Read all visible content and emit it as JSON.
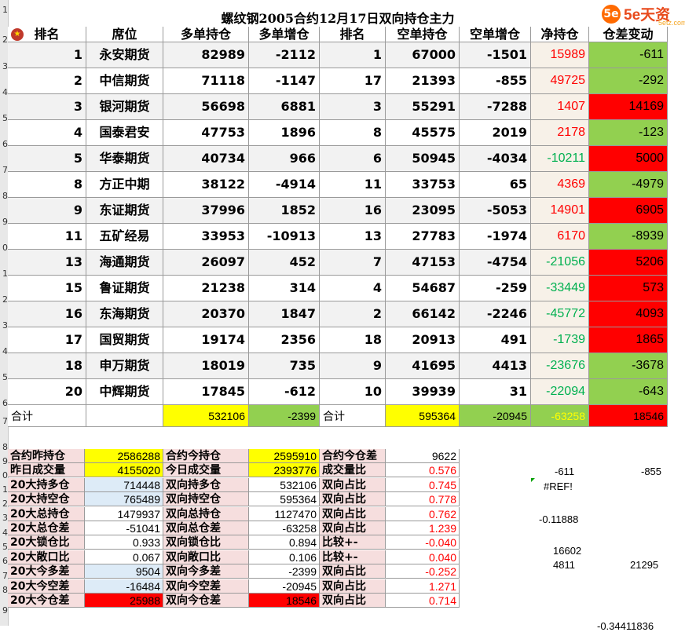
{
  "title": "螺纹钢2005合约12月17日双向持仓主力",
  "logo": {
    "mark": "5e",
    "text": "5e天资",
    "sub": "5etz.com"
  },
  "row_numbers": [
    "1",
    "2",
    "3",
    "4",
    "5",
    "6",
    "7",
    "8",
    "9",
    "0",
    "1",
    "2",
    "3",
    "4",
    "5",
    "6",
    "7",
    "8",
    "9",
    "0",
    "1",
    "2",
    "3",
    "4",
    "5",
    "6",
    "7",
    "8",
    "9"
  ],
  "headers": [
    "排名",
    "席位",
    "多单持仓",
    "多单增仓",
    "排名",
    "空单持仓",
    "空单增仓",
    "净持仓",
    "仓差变动"
  ],
  "rows": [
    {
      "rank": "1",
      "broker": "永安期货",
      "long": "82989",
      "long_chg": "-2112",
      "srank": "1",
      "short": "67000",
      "short_chg": "-1501",
      "net": "15989",
      "diff": "-611"
    },
    {
      "rank": "2",
      "broker": "中信期货",
      "long": "71118",
      "long_chg": "-1147",
      "srank": "17",
      "short": "21393",
      "short_chg": "-855",
      "net": "49725",
      "diff": "-292"
    },
    {
      "rank": "3",
      "broker": "银河期货",
      "long": "56698",
      "long_chg": "6881",
      "srank": "3",
      "short": "55291",
      "short_chg": "-7288",
      "net": "1407",
      "diff": "14169"
    },
    {
      "rank": "4",
      "broker": "国泰君安",
      "long": "47753",
      "long_chg": "1896",
      "srank": "8",
      "short": "45575",
      "short_chg": "2019",
      "net": "2178",
      "diff": "-123"
    },
    {
      "rank": "5",
      "broker": "华泰期货",
      "long": "40734",
      "long_chg": "966",
      "srank": "6",
      "short": "50945",
      "short_chg": "-4034",
      "net": "-10211",
      "diff": "5000"
    },
    {
      "rank": "8",
      "broker": "方正中期",
      "long": "38122",
      "long_chg": "-4914",
      "srank": "11",
      "short": "33753",
      "short_chg": "65",
      "net": "4369",
      "diff": "-4979"
    },
    {
      "rank": "9",
      "broker": "东证期货",
      "long": "37996",
      "long_chg": "1852",
      "srank": "16",
      "short": "23095",
      "short_chg": "-5053",
      "net": "14901",
      "diff": "6905"
    },
    {
      "rank": "11",
      "broker": "五矿经易",
      "long": "33953",
      "long_chg": "-10913",
      "srank": "13",
      "short": "27783",
      "short_chg": "-1974",
      "net": "6170",
      "diff": "-8939"
    },
    {
      "rank": "13",
      "broker": "海通期货",
      "long": "26097",
      "long_chg": "452",
      "srank": "7",
      "short": "47153",
      "short_chg": "-4754",
      "net": "-21056",
      "diff": "5206"
    },
    {
      "rank": "15",
      "broker": "鲁证期货",
      "long": "21238",
      "long_chg": "314",
      "srank": "4",
      "short": "54687",
      "short_chg": "-259",
      "net": "-33449",
      "diff": "573"
    },
    {
      "rank": "16",
      "broker": "东海期货",
      "long": "20370",
      "long_chg": "1847",
      "srank": "2",
      "short": "66142",
      "short_chg": "-2246",
      "net": "-45772",
      "diff": "4093"
    },
    {
      "rank": "17",
      "broker": "国贸期货",
      "long": "19174",
      "long_chg": "2356",
      "srank": "18",
      "short": "20913",
      "short_chg": "491",
      "net": "-1739",
      "diff": "1865"
    },
    {
      "rank": "18",
      "broker": "申万期货",
      "long": "18019",
      "long_chg": "735",
      "srank": "9",
      "short": "41695",
      "short_chg": "4413",
      "net": "-23676",
      "diff": "-3678"
    },
    {
      "rank": "20",
      "broker": "中辉期货",
      "long": "17845",
      "long_chg": "-612",
      "srank": "10",
      "short": "39939",
      "short_chg": "31",
      "net": "-22094",
      "diff": "-643"
    }
  ],
  "total": {
    "label": "合计",
    "long": "532106",
    "long_chg": "-2399",
    "label2": "合计",
    "short": "595364",
    "short_chg": "-20945",
    "net": "-63258",
    "diff": "18546"
  },
  "stats": [
    {
      "l1": "合约昨持仓",
      "v1": "2586288",
      "l2": "合约今持仓",
      "v2": "2595910",
      "l3": "合约今仓差",
      "v3": "9622"
    },
    {
      "l1": "昨日成交量",
      "v1": "4155020",
      "l2": "今日成交量",
      "v2": "2393776",
      "l3": "成交量比",
      "v3": "0.576"
    },
    {
      "l1": "20大持多仓",
      "v1": "714448",
      "l2": "双向持多仓",
      "v2": "532106",
      "l3": "双向占比",
      "v3": "0.745"
    },
    {
      "l1": "20大持空仓",
      "v1": "765489",
      "l2": "双向持空仓",
      "v2": "595364",
      "l3": "双向占比",
      "v3": "0.778"
    },
    {
      "l1": "20大总持仓",
      "v1": "1479937",
      "l2": "双向总持仓",
      "v2": "1127470",
      "l3": "双向占比",
      "v3": "0.762"
    },
    {
      "l1": "20大总仓差",
      "v1": "-51041",
      "l2": "双向总仓差",
      "v2": "-63258",
      "l3": "双向占比",
      "v3": "1.239"
    },
    {
      "l1": "20大锁仓比",
      "v1": "0.933",
      "l2": "双向锁仓比",
      "v2": "0.894",
      "l3": "比较+-",
      "v3": "-0.040"
    },
    {
      "l1": "20大敞口比",
      "v1": "0.067",
      "l2": "双向敞口比",
      "v2": "0.106",
      "l3": "比较+-",
      "v3": "0.040"
    },
    {
      "l1": "20大今多差",
      "v1": "9504",
      "l2": "双向今多差",
      "v2": "-2399",
      "l3": "双向占比",
      "v3": "-0.252"
    },
    {
      "l1": "20大今空差",
      "v1": "-16484",
      "l2": "双向今空差",
      "v2": "-20945",
      "l3": "双向占比",
      "v3": "1.271"
    },
    {
      "l1": "20大今仓差",
      "v1": "25988",
      "l2": "双向今仓差",
      "v2": "18546",
      "l3": "双向占比",
      "v3": "0.714"
    }
  ],
  "extra": {
    "a": "-611",
    "b": "-855",
    "ref": "#REF!",
    "c": "-0.11888",
    "d": "16602",
    "e": "4811",
    "f": "21295",
    "g": "-0.34411836"
  }
}
